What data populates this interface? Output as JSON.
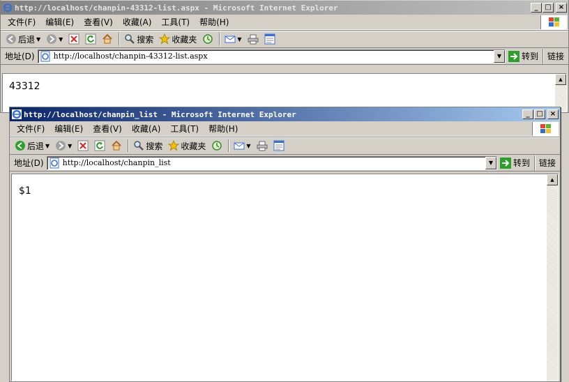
{
  "back_window": {
    "title": "http://localhost/chanpin-43312-list.aspx - Microsoft Internet Explorer",
    "menu": [
      "文件(F)",
      "编辑(E)",
      "查看(V)",
      "收藏(A)",
      "工具(T)",
      "帮助(H)"
    ],
    "toolbar": {
      "back": "后退",
      "search": "搜索",
      "favorites": "收藏夹"
    },
    "address_label": "地址(D)",
    "address_value": "http://localhost/chanpin-43312-list.aspx",
    "go_label": "转到",
    "links_label": "链接",
    "page_text": "43312"
  },
  "front_window": {
    "title": "http://localhost/chanpin_list - Microsoft Internet Explorer",
    "menu": [
      "文件(F)",
      "编辑(E)",
      "查看(V)",
      "收藏(A)",
      "工具(T)",
      "帮助(H)"
    ],
    "toolbar": {
      "back": "后退",
      "search": "搜索",
      "favorites": "收藏夹"
    },
    "address_label": "地址(D)",
    "address_value": "http://localhost/chanpin_list",
    "go_label": "转到",
    "links_label": "链接",
    "page_text": "$1"
  },
  "caption_buttons": {
    "minimize": "_",
    "maximize": "□",
    "close": "×"
  },
  "colors": {
    "active_title_start": "#0a246a",
    "active_title_end": "#a6caf0",
    "inactive_title": "#808080",
    "chrome": "#d4d0c8"
  }
}
